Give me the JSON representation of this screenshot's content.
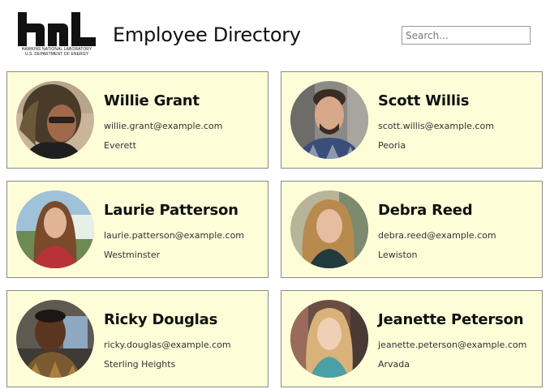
{
  "header": {
    "logo_text": "hnl",
    "logo_line_1": "HAWKINS NATIONAL LABORATORY",
    "logo_line_2": "U.S. DEPARTMENT OF ENERGY",
    "title": "Employee Directory"
  },
  "search": {
    "placeholder": "Search...",
    "value": ""
  },
  "employees": [
    {
      "name": "Willie Grant",
      "email": "willie.grant@example.com",
      "city": "Everett"
    },
    {
      "name": "Scott Willis",
      "email": "scott.willis@example.com",
      "city": "Peoria"
    },
    {
      "name": "Laurie Patterson",
      "email": "laurie.patterson@example.com",
      "city": "Westminster"
    },
    {
      "name": "Debra Reed",
      "email": "debra.reed@example.com",
      "city": "Lewiston"
    },
    {
      "name": "Ricky Douglas",
      "email": "ricky.douglas@example.com",
      "city": "Sterling Heights"
    },
    {
      "name": "Jeanette Peterson",
      "email": "jeanette.peterson@example.com",
      "city": "Arvada"
    }
  ],
  "colors": {
    "card_background": "#fdfdd8",
    "card_border": "#8a8a8a",
    "text": "#111111"
  }
}
